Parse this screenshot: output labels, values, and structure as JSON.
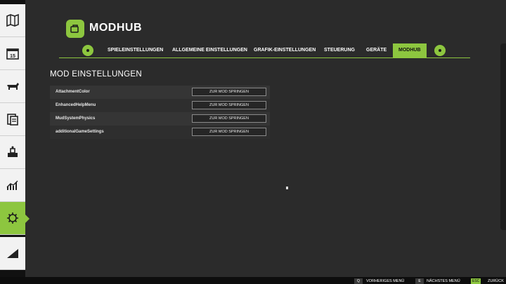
{
  "header": {
    "title": "MODHUB"
  },
  "tabs": [
    {
      "label": "SPIELEINSTELLUNGEN",
      "active": false
    },
    {
      "label": "ALLGEMEINE EINSTELLUNGEN",
      "active": false
    },
    {
      "label": "GRAFIK-EINSTELLUNGEN",
      "active": false
    },
    {
      "label": "STEUERUNG",
      "active": false
    },
    {
      "label": "GERÄTE",
      "active": false
    },
    {
      "label": "MODHUB",
      "active": true
    }
  ],
  "section": {
    "title": "MOD EINSTELLUNGEN"
  },
  "mods": [
    {
      "name": "AttachmentColor",
      "button": "ZUR MOD SPRINGEN"
    },
    {
      "name": "EnhancedHelpMenu",
      "button": "ZUR MOD SPRINGEN"
    },
    {
      "name": "MudSystemPhysics",
      "button": "ZUR MOD SPRINGEN"
    },
    {
      "name": "additionalGameSettings",
      "button": "ZUR MOD SPRINGEN"
    }
  ],
  "sidebar": {
    "items": [
      {
        "icon": "map-icon"
      },
      {
        "icon": "calendar-icon",
        "text": "15"
      },
      {
        "icon": "animals-icon"
      },
      {
        "icon": "contracts-icon"
      },
      {
        "icon": "production-icon"
      },
      {
        "icon": "statistics-icon"
      },
      {
        "icon": "settings-icon",
        "active": true
      },
      {
        "icon": "help-icon"
      }
    ]
  },
  "footer": {
    "prev": {
      "key": "Q",
      "label": "VORHERIGES MENÜ"
    },
    "next": {
      "key": "E",
      "label": "NÄCHSTES MENÜ"
    },
    "back": {
      "key": "ESC",
      "label": "ZURÜCK"
    }
  },
  "colors": {
    "accent": "#8dc63f",
    "background": "#2b2b2b",
    "sidebar": "#f2f2f2"
  }
}
